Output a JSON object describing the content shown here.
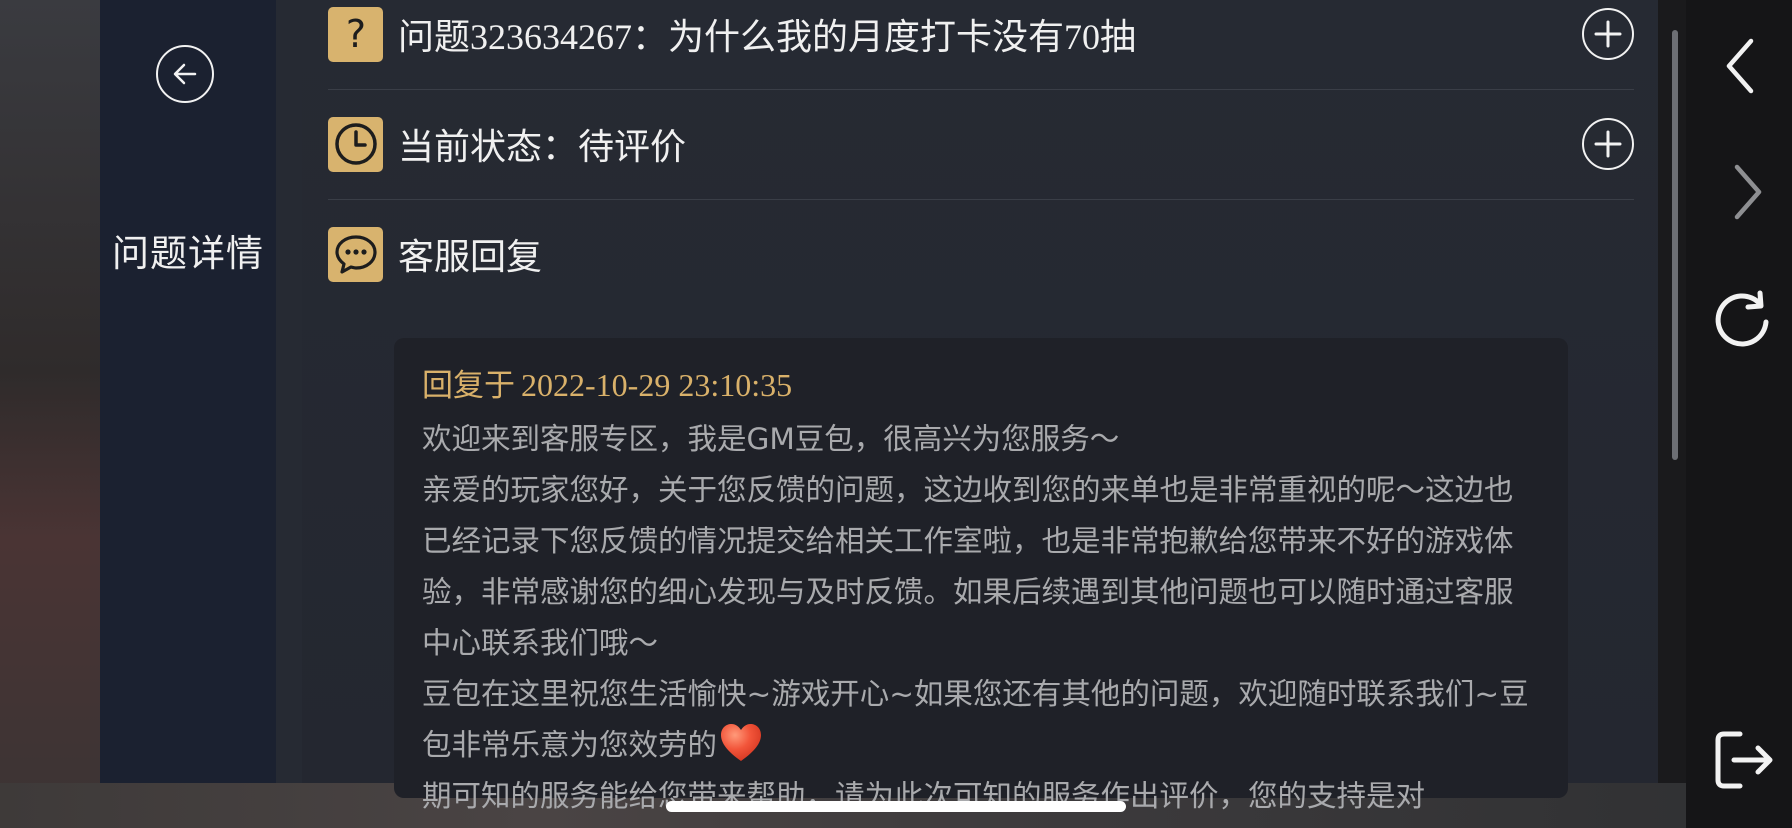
{
  "sidebar": {
    "title": "问题详情",
    "back_icon": "arrow-left-icon"
  },
  "question": {
    "prefix": "问题",
    "id": "323634267",
    "sep": "：为什么我的月度打卡没有",
    "count": "70",
    "suffix": "抽"
  },
  "status": {
    "label": "当前状态：待评价"
  },
  "service": {
    "label": "客服回复"
  },
  "reply": {
    "prefix": "回复于",
    "date": "2022-10-29 23:10:35",
    "paragraphs": [
      "欢迎来到客服专区，我是GM豆包，很高兴为您服务～",
      "亲爱的玩家您好，关于您反馈的问题，这边收到您的来单也是非常重视的呢～这边也已经记录下您反馈的情况提交给相关工作室啦，也是非常抱歉给您带来不好的游戏体验，非常感谢您的细心发现与及时反馈。如果后续遇到其他问题也可以随时通过客服中心联系我们哦～",
      "豆包在这里祝您生活愉快~游戏开心~如果您还有其他的问题，欢迎随时联系我们~豆包非常乐意为您效劳的",
      "期可知的服务能给您带来帮助，请为此次可知的服务作出评价，您的支持是对"
    ]
  },
  "colors": {
    "accent": "#d8b36e",
    "sidebar": "#1b2130",
    "panel": "#262a33",
    "card": "#1f2128"
  },
  "browser": {
    "back": "chevron-left-icon",
    "forward": "chevron-right-icon",
    "reload": "reload-icon",
    "exit": "exit-icon"
  }
}
